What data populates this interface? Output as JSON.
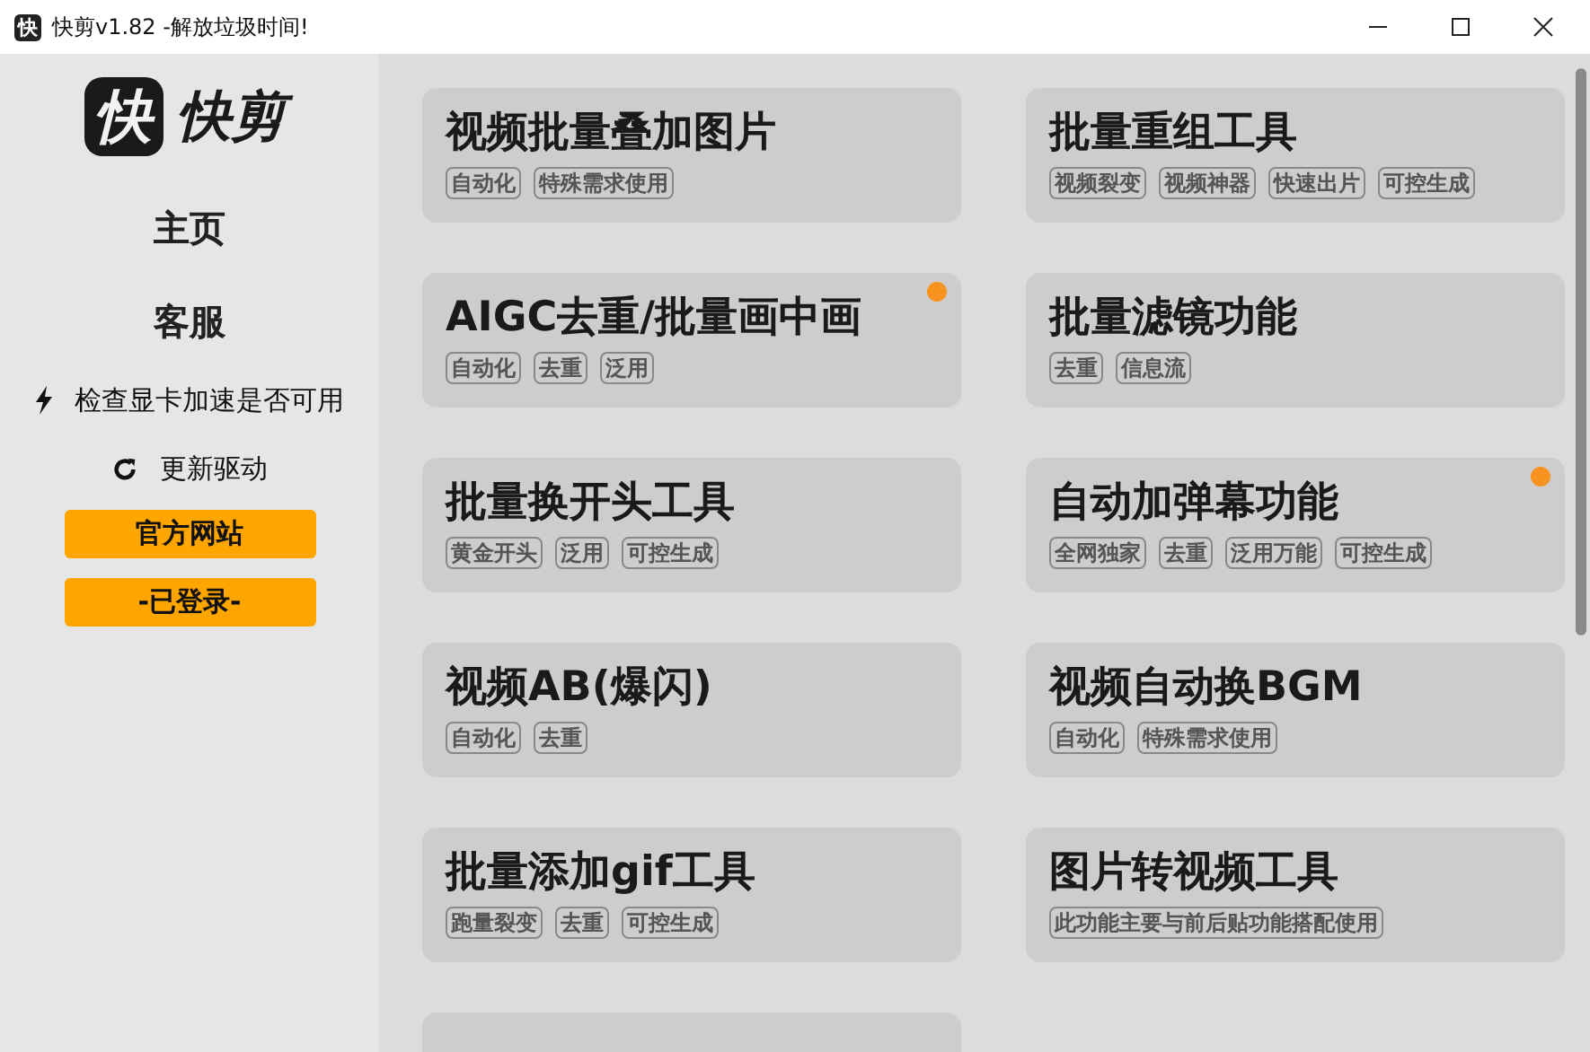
{
  "window": {
    "icon_glyph": "快",
    "title": "快剪v1.82 -解放垃圾时间!"
  },
  "sidebar": {
    "logo_text": "快剪",
    "logo_glyph": "快",
    "nav": [
      {
        "label": "主页"
      },
      {
        "label": "客服"
      }
    ],
    "actions": [
      {
        "kind": "bolt",
        "label": "检查显卡加速是否可用"
      },
      {
        "kind": "refresh",
        "label": "更新驱动"
      }
    ],
    "buttons": [
      "官方网站",
      "-已登录-"
    ]
  },
  "cards": [
    {
      "title": "视频批量叠加图片",
      "tags": [
        "自动化",
        "特殊需求使用"
      ],
      "dot": false
    },
    {
      "title": "批量重组工具",
      "tags": [
        "视频裂变",
        "视频神器",
        "快速出片",
        "可控生成"
      ],
      "dot": false
    },
    {
      "title": "AIGC去重/批量画中画",
      "tags": [
        "自动化",
        "去重",
        "泛用"
      ],
      "dot": true
    },
    {
      "title": "批量滤镜功能",
      "tags": [
        "去重",
        "信息流"
      ],
      "dot": false
    },
    {
      "title": "批量换开头工具",
      "tags": [
        "黄金开头",
        "泛用",
        "可控生成"
      ],
      "dot": false
    },
    {
      "title": "自动加弹幕功能",
      "tags": [
        "全网独家",
        "去重",
        "泛用万能",
        "可控生成"
      ],
      "dot": true
    },
    {
      "title": "视频AB(爆闪)",
      "tags": [
        "自动化",
        "去重"
      ],
      "dot": false
    },
    {
      "title": "视频自动换BGM",
      "tags": [
        "自动化",
        "特殊需求使用"
      ],
      "dot": false
    },
    {
      "title": "批量添加gif工具",
      "tags": [
        "跑量裂变",
        "去重",
        "可控生成"
      ],
      "dot": false
    },
    {
      "title": "图片转视频工具",
      "tags": [
        "此功能主要与前后贴功能搭配使用"
      ],
      "dot": false
    }
  ]
}
